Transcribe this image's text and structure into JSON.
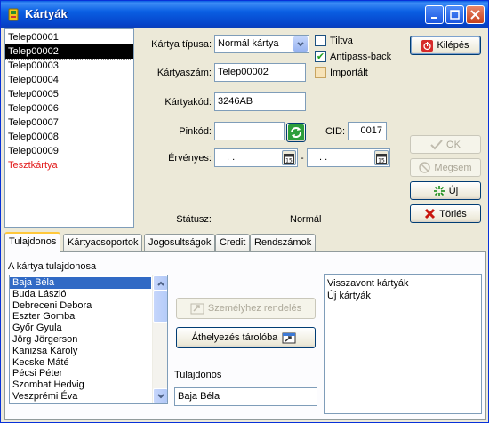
{
  "window": {
    "title": "Kártyák"
  },
  "cards": {
    "items": [
      {
        "label": "Telep00001",
        "selected": false,
        "red": false
      },
      {
        "label": "Telep00002",
        "selected": true,
        "red": false
      },
      {
        "label": "Telep00003",
        "selected": false,
        "red": false
      },
      {
        "label": "Telep00004",
        "selected": false,
        "red": false
      },
      {
        "label": "Telep00005",
        "selected": false,
        "red": false
      },
      {
        "label": "Telep00006",
        "selected": false,
        "red": false
      },
      {
        "label": "Telep00007",
        "selected": false,
        "red": false
      },
      {
        "label": "Telep00008",
        "selected": false,
        "red": false
      },
      {
        "label": "Telep00009",
        "selected": false,
        "red": false
      },
      {
        "label": "Tesztkártya",
        "selected": false,
        "red": true
      }
    ]
  },
  "form": {
    "card_type_label": "Kártya típusa:",
    "card_type_value": "Normál kártya",
    "card_number_label": "Kártyaszám:",
    "card_number_value": "Telep00002",
    "card_code_label": "Kártyakód:",
    "card_code_value": "3246AB",
    "pin_label": "Pinkód:",
    "pin_value": "",
    "cid_label": "CID:",
    "cid_value": "0017",
    "valid_label": "Érvényes:",
    "valid_from": " .  .",
    "valid_to": " .  .",
    "valid_sep": "-",
    "status_label": "Státusz:",
    "status_value": "Normál",
    "blocked_label": "Tiltva",
    "blocked_checked": false,
    "antipass_label": "Antipass-back",
    "antipass_checked": true,
    "imported_label": "Importált",
    "imported_checked": false
  },
  "buttons": {
    "exit": "Kilépés",
    "ok": "OK",
    "cancel": "Mégsem",
    "new": "Új",
    "delete": "Törlés"
  },
  "tabs": [
    {
      "label": "Tulajdonos",
      "active": true
    },
    {
      "label": "Kártyacsoportok",
      "active": false
    },
    {
      "label": "Jogosultságok",
      "active": false
    },
    {
      "label": "Credit",
      "active": false
    },
    {
      "label": "Rendszámok",
      "active": false
    }
  ],
  "owner": {
    "section_label": "A kártya tulajdonosa",
    "people": [
      {
        "label": "Baja Béla",
        "selected": true
      },
      {
        "label": "Buda László",
        "selected": false
      },
      {
        "label": "Debreceni Debora",
        "selected": false
      },
      {
        "label": "Eszter Gomba",
        "selected": false
      },
      {
        "label": "Győr Gyula",
        "selected": false
      },
      {
        "label": "Jörg Jörgerson",
        "selected": false
      },
      {
        "label": "Kanizsa Károly",
        "selected": false
      },
      {
        "label": "Kecske Máté",
        "selected": false
      },
      {
        "label": "Pécsi Péter",
        "selected": false
      },
      {
        "label": "Szombat Hedvig",
        "selected": false
      },
      {
        "label": "Veszprémi Éva",
        "selected": false
      }
    ],
    "assign_button": "Személyhez rendelés",
    "move_button": "Áthelyezés tárolóba",
    "owner_label": "Tulajdonos",
    "owner_value": "Baja Béla",
    "storage_items": [
      "Visszavont kártyák",
      "Új kártyák"
    ]
  }
}
